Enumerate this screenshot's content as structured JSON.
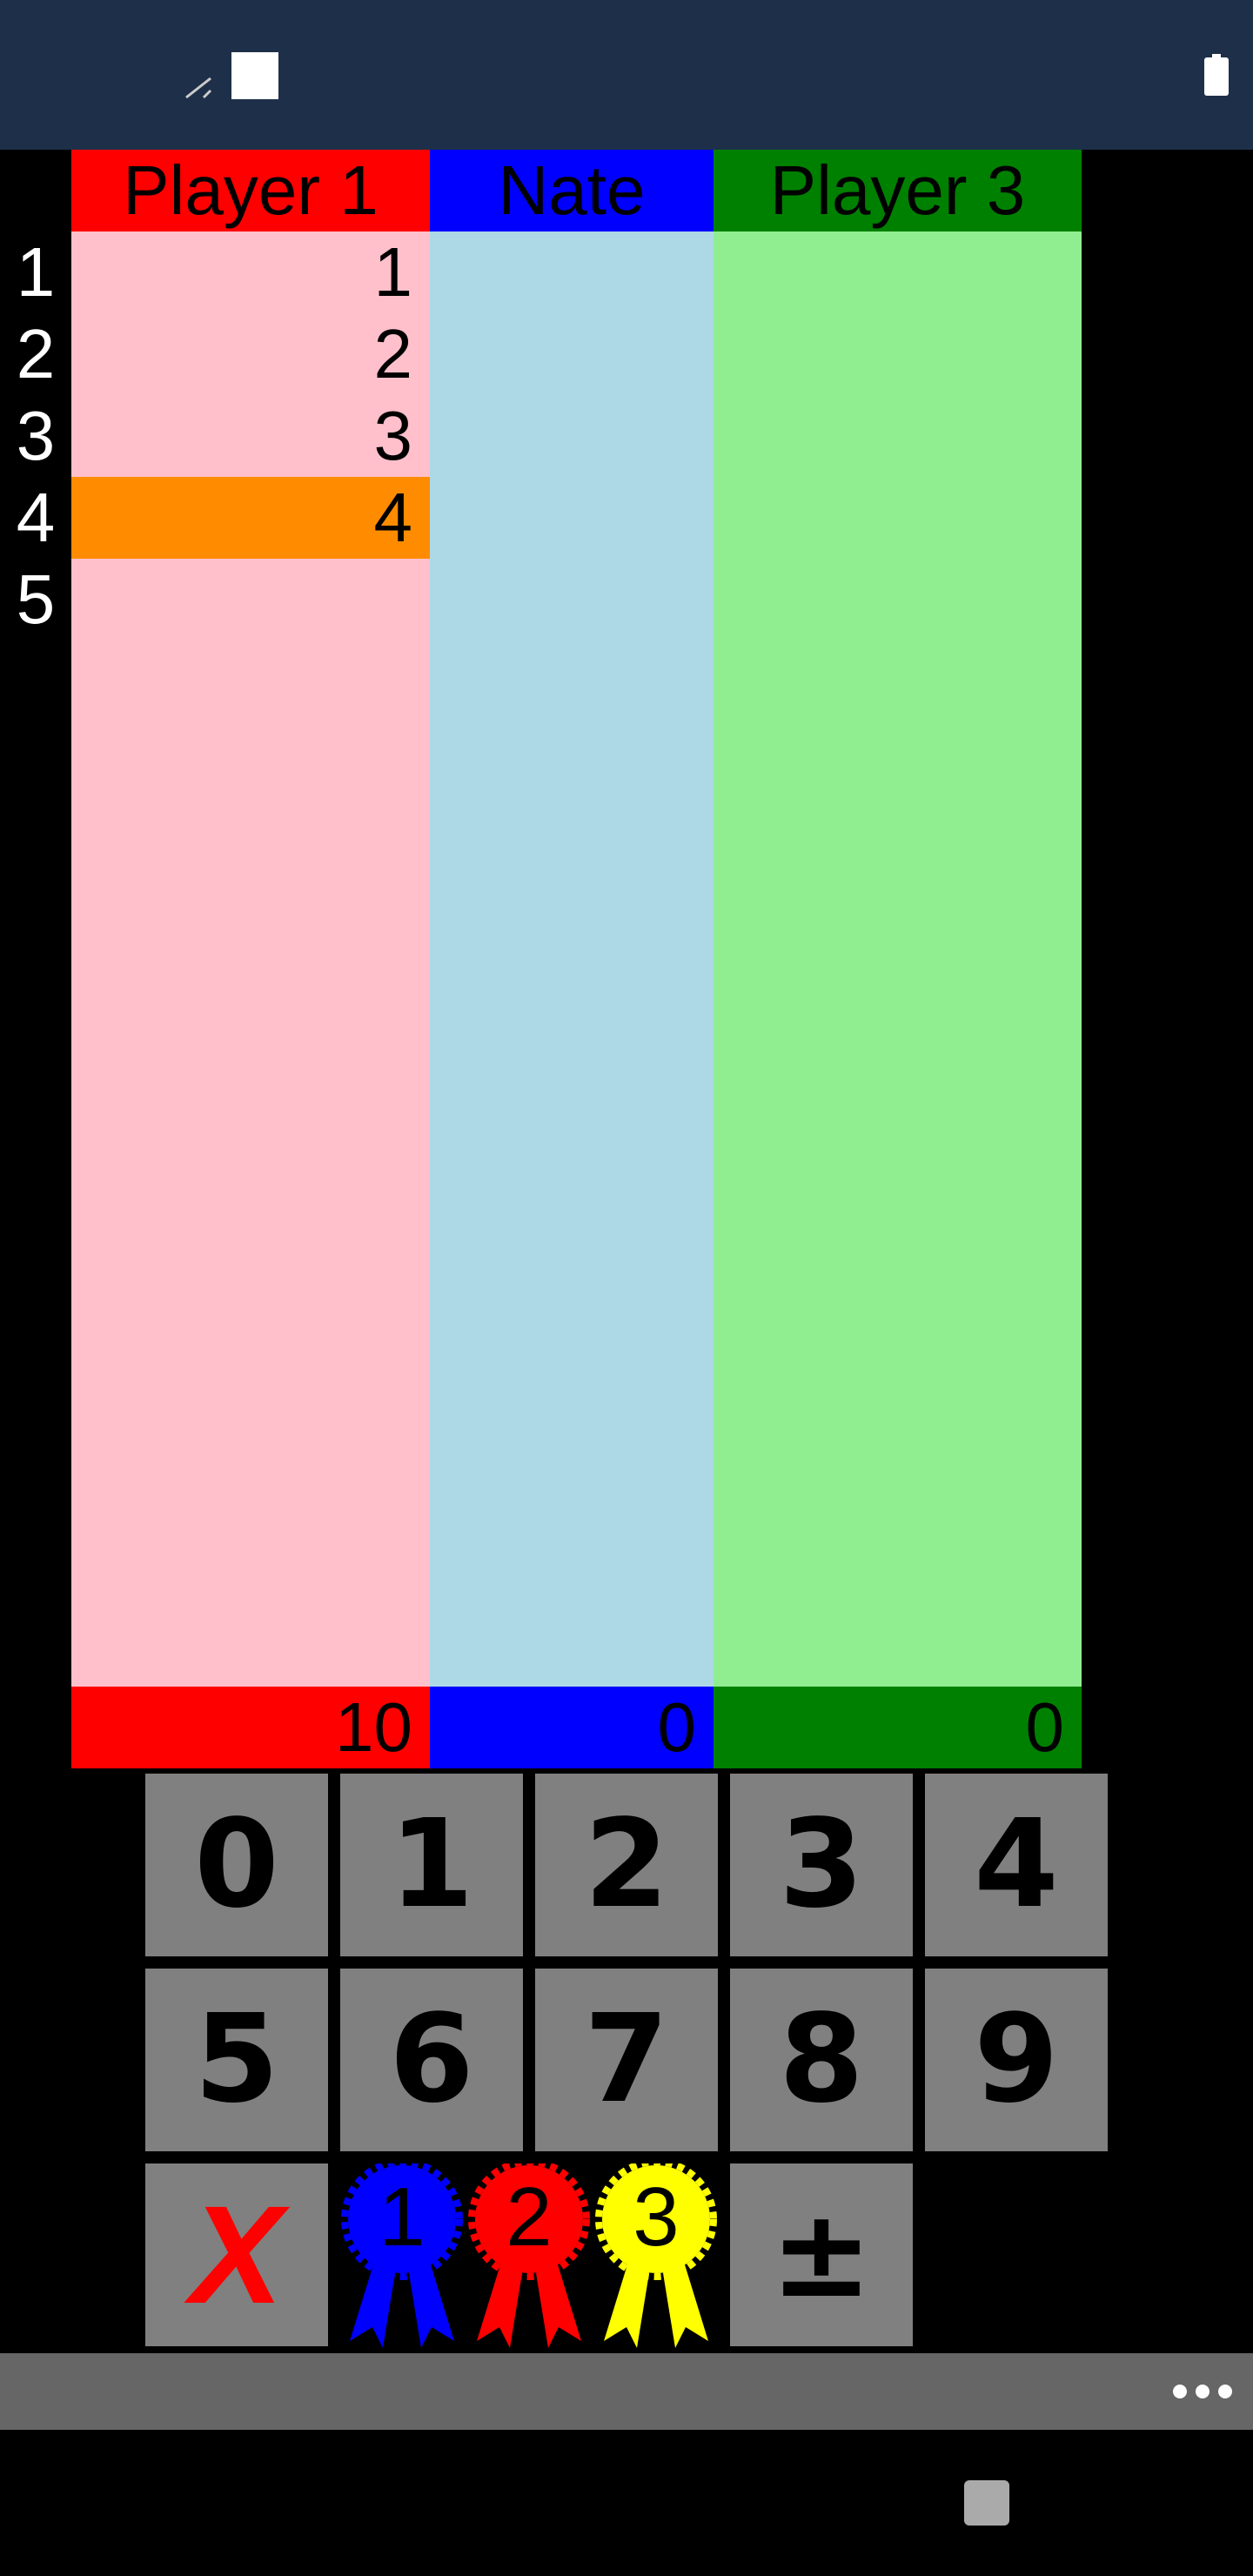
{
  "status_bar": {
    "icons": [
      "signal-icon",
      "notification-square-icon",
      "battery-icon"
    ]
  },
  "players": [
    {
      "name": "Player 1",
      "total": "10",
      "header_color": "#ff0000",
      "column_color": "#ffc0cb"
    },
    {
      "name": "Nate",
      "total": "0",
      "header_color": "#0000ff",
      "column_color": "#add8e6"
    },
    {
      "name": "Player 3",
      "total": "0",
      "header_color": "#008000",
      "column_color": "#90ee90"
    }
  ],
  "rows": [
    "1",
    "2",
    "3",
    "4",
    "5"
  ],
  "scores": {
    "player1": [
      "1",
      "2",
      "3",
      "4"
    ]
  },
  "highlight_color": "#ff8c00",
  "keypad": {
    "digits": [
      "0",
      "1",
      "2",
      "3",
      "4",
      "5",
      "6",
      "7",
      "8",
      "9"
    ],
    "clear_label": "X",
    "plus_minus_label": "±",
    "ribbons": [
      {
        "label": "1",
        "color": "#0000ff"
      },
      {
        "label": "2",
        "color": "#ff0000"
      },
      {
        "label": "3",
        "color": "#ffff00"
      }
    ]
  },
  "toolbar": {
    "icons": [
      "overflow-menu-icon"
    ]
  }
}
